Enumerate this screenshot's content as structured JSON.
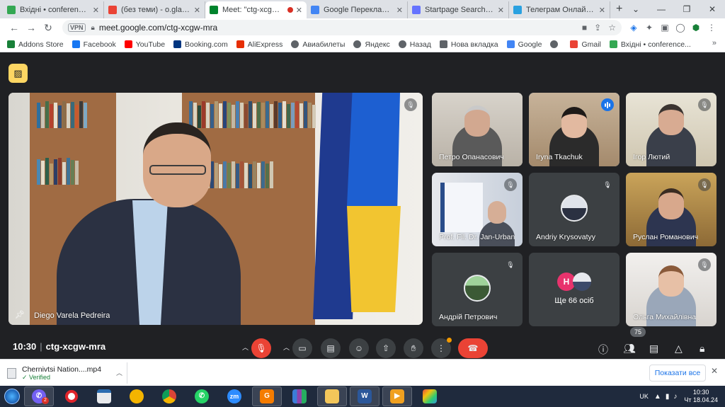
{
  "tabs": [
    {
      "label": "Вхідні • conference_find",
      "color": "#34a853",
      "active": false
    },
    {
      "label": "(без теми) - o.gladchuk",
      "color": "#ea4335",
      "active": false
    },
    {
      "label": "Meet: \"ctg-xcgw-m",
      "color": "#00832d",
      "active": true
    },
    {
      "label": "Google Перекладач",
      "color": "#4285f4",
      "active": false
    },
    {
      "label": "Startpage Search Results",
      "color": "#6573ff",
      "active": false
    },
    {
      "label": "Телеграм Онлайн (нео",
      "color": "#2aa1e0",
      "active": false
    }
  ],
  "address": {
    "url": "meet.google.com/ctg-xcgw-mra",
    "vpn": "VPN"
  },
  "bookmarks": [
    {
      "label": "Addons Store",
      "color": "#188038"
    },
    {
      "label": "Facebook",
      "color": "#1877f2"
    },
    {
      "label": "YouTube",
      "color": "#ff0000"
    },
    {
      "label": "Booking.com",
      "color": "#003580"
    },
    {
      "label": "AliExpress",
      "color": "#e62e04"
    },
    {
      "label": "Авиабилеты",
      "color": "#5f6368"
    },
    {
      "label": "Яндекс",
      "color": "#5f6368"
    },
    {
      "label": "Назад",
      "color": "#5f6368"
    },
    {
      "label": "Нова вкладка",
      "color": "#5f6368"
    },
    {
      "label": "Google",
      "color": "#4285f4"
    },
    {
      "label": "",
      "color": "#5f6368"
    },
    {
      "label": "Gmail",
      "color": "#ea4335"
    },
    {
      "label": "Вхідні • conference...",
      "color": "#34a853"
    }
  ],
  "meet": {
    "main_participant": "Diego Varela Pedreira",
    "participants": [
      "Петро Опанасович",
      "Iryna Tkachuk",
      "Ігор Лютий",
      "Prof. Fil. Dr. Jan-Urban",
      "Andriy Krysovatyy",
      "Руслан Романович",
      "Андрій Петрович",
      "Ольга Михайлівна"
    ],
    "more_initial": "Н",
    "more_count": "Ще 66 осіб",
    "time": "10:30",
    "meeting_code": "ctg-xcgw-mra",
    "participant_badge": "75"
  },
  "download": {
    "filename": "Chernivtsi Nation....mp4",
    "status": "Verified",
    "show_all": "Показати все"
  },
  "taskbar": {
    "lang": "UK",
    "time": "10:30",
    "date": "Чт 18.04.24",
    "viber_badge": "2",
    "zoom_label": "zm"
  }
}
